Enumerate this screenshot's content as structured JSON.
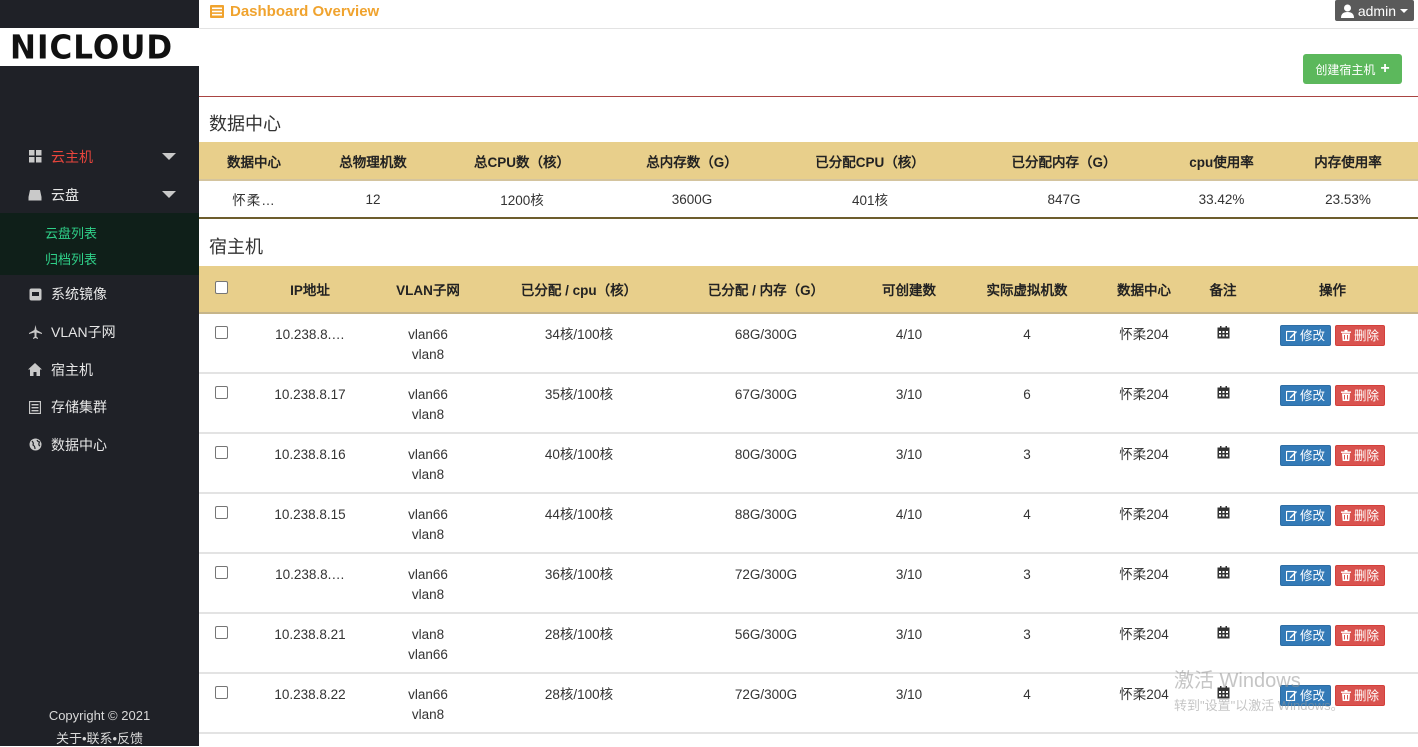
{
  "brand": {
    "logo_text": "NICLOUD"
  },
  "sidebar": {
    "items": [
      {
        "label": "云主机",
        "icon": "grid-icon",
        "active": true,
        "expandable": true
      },
      {
        "label": "云盘",
        "icon": "drive-icon",
        "active": false,
        "expandable": true
      },
      {
        "label": "系统镜像",
        "icon": "disc-icon"
      },
      {
        "label": "VLAN子网",
        "icon": "plane-icon"
      },
      {
        "label": "宿主机",
        "icon": "home-icon"
      },
      {
        "label": "存储集群",
        "icon": "list-icon"
      },
      {
        "label": "数据中心",
        "icon": "globe-icon"
      }
    ],
    "sub_items": [
      "云盘列表",
      "归档列表"
    ],
    "copyright_line1": "Copyright © 2021",
    "copyright_line2": "关于•联系•反馈"
  },
  "header": {
    "title": "Dashboard Overview",
    "user": "admin"
  },
  "actions": {
    "create_host": "创建宿主机"
  },
  "datacenter": {
    "section_title": "数据中心",
    "columns": [
      "数据中心",
      "总物理机数",
      "总CPU数（核）",
      "总内存数（G）",
      "已分配CPU（核）",
      "已分配内存（G）",
      "cpu使用率",
      "内存使用率"
    ],
    "row": [
      "​怀柔…",
      "12",
      "1200核",
      "3600G",
      "401核",
      "847G",
      "33.42%",
      "23.53%"
    ]
  },
  "hosts": {
    "section_title": "宿主机",
    "columns": [
      "",
      "IP地址",
      "VLAN子网",
      "已分配 / cpu（核）",
      "已分配 / 内存（G）",
      "可创建数",
      "实际虚拟机数",
      "数据中心",
      "备注",
      "操作"
    ],
    "edit_label": "修改",
    "delete_label": "删除",
    "rows": [
      {
        "ip": "10.238.8.…",
        "vlan1": "vlan66",
        "vlan2": "vlan8",
        "cpu": "34核/100核",
        "mem": "68G/300G",
        "can_create": "4/10",
        "vms": "4",
        "dc": "怀柔204"
      },
      {
        "ip": "10.238.8.17",
        "vlan1": "vlan66",
        "vlan2": "vlan8",
        "cpu": "35核/100核",
        "mem": "67G/300G",
        "can_create": "3/10",
        "vms": "6",
        "dc": "怀柔204"
      },
      {
        "ip": "10.238.8.16",
        "vlan1": "vlan66",
        "vlan2": "vlan8",
        "cpu": "40核/100核",
        "mem": "80G/300G",
        "can_create": "3/10",
        "vms": "3",
        "dc": "怀柔204"
      },
      {
        "ip": "10.238.8.15",
        "vlan1": "vlan66",
        "vlan2": "vlan8",
        "cpu": "44核/100核",
        "mem": "88G/300G",
        "can_create": "4/10",
        "vms": "4",
        "dc": "怀柔204"
      },
      {
        "ip": "10.238.8.…",
        "vlan1": "vlan66",
        "vlan2": "vlan8",
        "cpu": "36核/100核",
        "mem": "72G/300G",
        "can_create": "3/10",
        "vms": "3",
        "dc": "怀柔204"
      },
      {
        "ip": "10.238.8.21",
        "vlan1": "vlan8",
        "vlan2": "vlan66",
        "cpu": "28核/100核",
        "mem": "56G/300G",
        "can_create": "3/10",
        "vms": "3",
        "dc": "怀柔204"
      },
      {
        "ip": "10.238.8.22",
        "vlan1": "vlan66",
        "vlan2": "vlan8",
        "cpu": "28核/100核",
        "mem": "72G/300G",
        "can_create": "3/10",
        "vms": "4",
        "dc": "怀柔204"
      }
    ]
  },
  "watermark": {
    "line1": "激活 Windows",
    "line2": "转到\"设置\"以激活 Windows。"
  }
}
